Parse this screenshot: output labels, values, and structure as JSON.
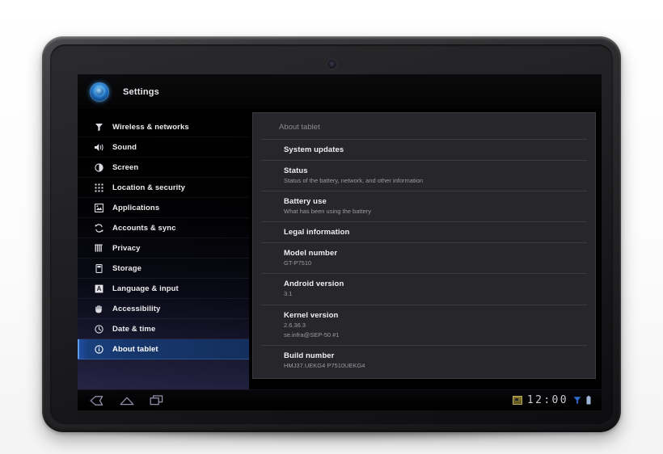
{
  "device": {
    "type": "android-tablet",
    "camera": "front-camera-lens",
    "led": "notification-led"
  },
  "actionbar": {
    "app_icon": "settings-orb-icon",
    "title": "Settings"
  },
  "sidebar": {
    "items": [
      {
        "label": "Wireless & networks",
        "icon": "wireless-icon",
        "selected": false
      },
      {
        "label": "Sound",
        "icon": "sound-speaker-icon",
        "selected": false
      },
      {
        "label": "Screen",
        "icon": "screen-brightness-icon",
        "selected": false
      },
      {
        "label": "Location & security",
        "icon": "location-grid-icon",
        "selected": false
      },
      {
        "label": "Applications",
        "icon": "applications-icon",
        "selected": false
      },
      {
        "label": "Accounts & sync",
        "icon": "accounts-sync-icon",
        "selected": false
      },
      {
        "label": "Privacy",
        "icon": "privacy-icon",
        "selected": false
      },
      {
        "label": "Storage",
        "icon": "storage-icon",
        "selected": false
      },
      {
        "label": "Language & input",
        "icon": "language-input-icon",
        "selected": false
      },
      {
        "label": "Accessibility",
        "icon": "accessibility-hand-icon",
        "selected": false
      },
      {
        "label": "Date & time",
        "icon": "clock-icon",
        "selected": false
      },
      {
        "label": "About tablet",
        "icon": "info-icon",
        "selected": true
      }
    ]
  },
  "panel": {
    "title": "About tablet",
    "rows": [
      {
        "title": "System updates",
        "sub": "",
        "sub2": ""
      },
      {
        "title": "Status",
        "sub": "Status of the battery, network, and other information",
        "sub2": ""
      },
      {
        "title": "Battery use",
        "sub": "What has been using the battery",
        "sub2": ""
      },
      {
        "title": "Legal information",
        "sub": "",
        "sub2": ""
      },
      {
        "title": "Model number",
        "sub": "GT-P7510",
        "sub2": ""
      },
      {
        "title": "Android version",
        "sub": "3.1",
        "sub2": ""
      },
      {
        "title": "Kernel version",
        "sub": "2.6.36.3",
        "sub2": "se.infra@SEP-50 #1"
      },
      {
        "title": "Build number",
        "sub": "HMJ37.UEKG4 P7510UEKG4",
        "sub2": ""
      }
    ]
  },
  "systembar": {
    "back": "back-icon",
    "home": "home-icon",
    "recents": "recent-apps-icon",
    "notification": "screenshot-notification-icon",
    "clock": "12:00",
    "wifi": "wifi-icon",
    "battery": "battery-icon"
  },
  "colors": {
    "accent_selected": "#16376d",
    "accent_edge": "#5f9bea",
    "panel_bg": "#27272b",
    "screen_bg": "#000000",
    "text_primary": "#f0f0f2",
    "text_secondary": "#9a9aa2"
  }
}
